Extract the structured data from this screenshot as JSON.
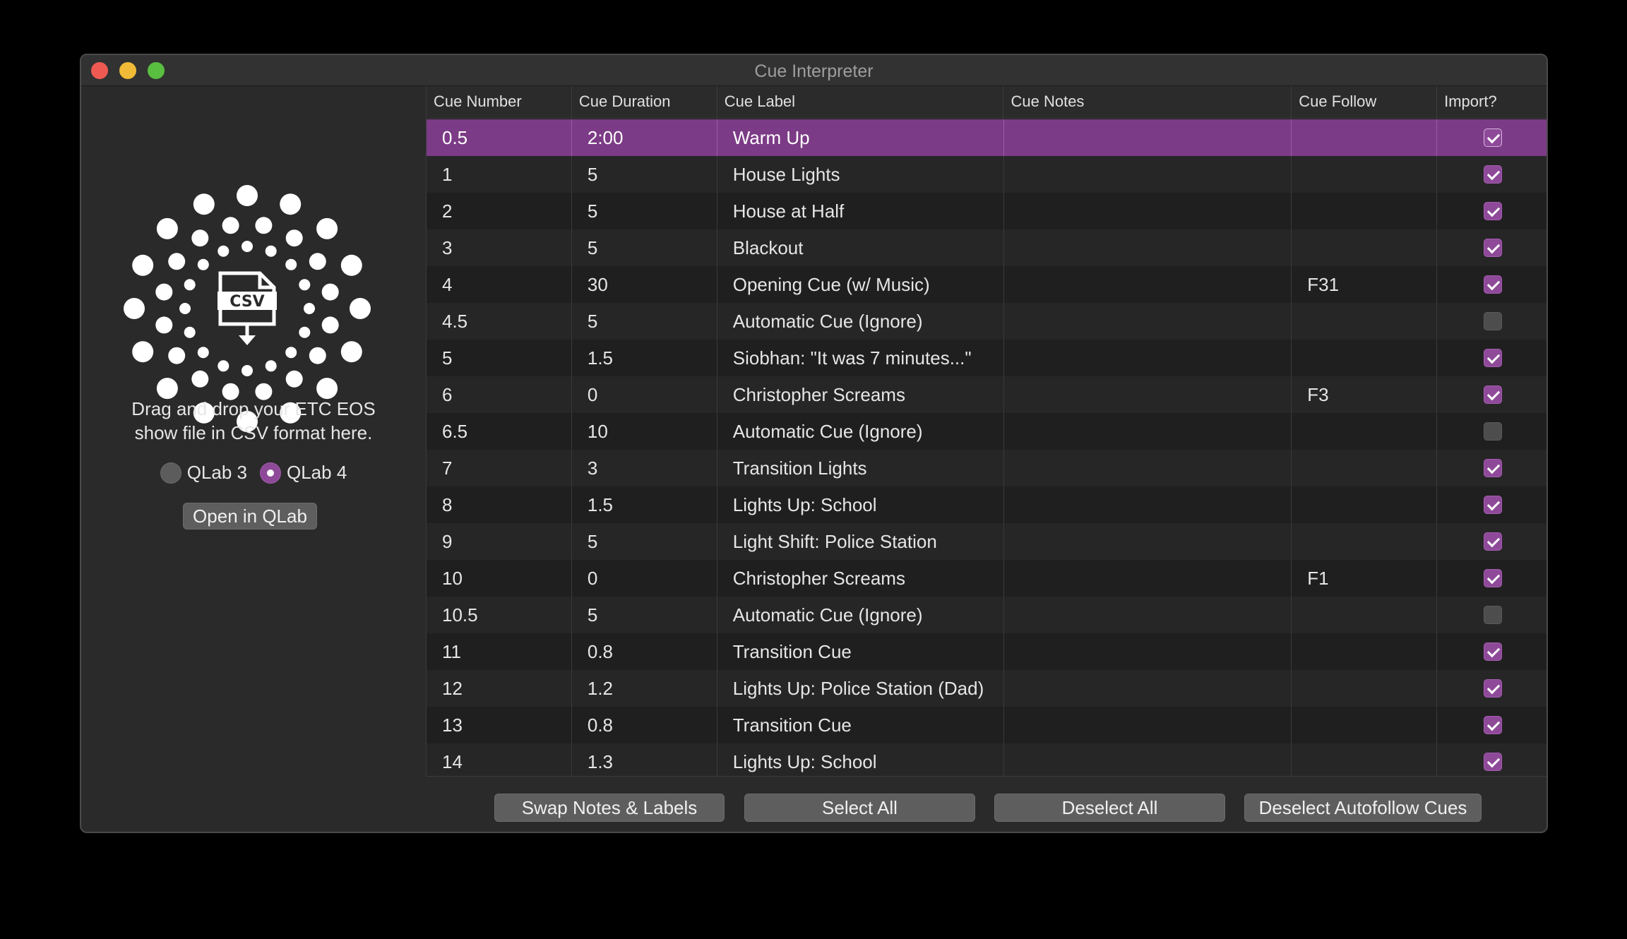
{
  "window": {
    "title": "Cue Interpreter"
  },
  "left_pane": {
    "drop_icon": "csv-file-download-icon",
    "drop_icon_text": "CSV",
    "instructions_line1": "Drag and drop your ETC EOS",
    "instructions_line2": "show file in CSV format here.",
    "radio_options": [
      {
        "label": "QLab 3",
        "selected": false
      },
      {
        "label": "QLab 4",
        "selected": true
      }
    ],
    "open_button": "Open in QLab"
  },
  "table": {
    "columns": [
      "Cue Number",
      "Cue Duration",
      "Cue Label",
      "Cue Notes",
      "Cue Follow",
      "Import?"
    ],
    "rows": [
      {
        "number": "0.5",
        "duration": "2:00",
        "label": "Warm Up",
        "notes": "",
        "follow": "",
        "import": true,
        "selected": true
      },
      {
        "number": "1",
        "duration": "5",
        "label": "House Lights",
        "notes": "",
        "follow": "",
        "import": true
      },
      {
        "number": "2",
        "duration": "5",
        "label": "House at Half",
        "notes": "",
        "follow": "",
        "import": true
      },
      {
        "number": "3",
        "duration": "5",
        "label": "Blackout",
        "notes": "",
        "follow": "",
        "import": true
      },
      {
        "number": "4",
        "duration": "30",
        "label": "Opening Cue (w/ Music)",
        "notes": "",
        "follow": "F31",
        "import": true
      },
      {
        "number": "4.5",
        "duration": "5",
        "label": "Automatic Cue (Ignore)",
        "notes": "",
        "follow": "",
        "import": false
      },
      {
        "number": "5",
        "duration": "1.5",
        "label": "Siobhan: \"It was 7 minutes...\"",
        "notes": "",
        "follow": "",
        "import": true
      },
      {
        "number": "6",
        "duration": "0",
        "label": "Christopher Screams",
        "notes": "",
        "follow": "F3",
        "import": true
      },
      {
        "number": "6.5",
        "duration": "10",
        "label": "Automatic Cue (Ignore)",
        "notes": "",
        "follow": "",
        "import": false
      },
      {
        "number": "7",
        "duration": "3",
        "label": "Transition Lights",
        "notes": "",
        "follow": "",
        "import": true
      },
      {
        "number": "8",
        "duration": "1.5",
        "label": "Lights Up: School",
        "notes": "",
        "follow": "",
        "import": true
      },
      {
        "number": "9",
        "duration": "5",
        "label": "Light Shift: Police Station",
        "notes": "",
        "follow": "",
        "import": true
      },
      {
        "number": "10",
        "duration": "0",
        "label": "Christopher Screams",
        "notes": "",
        "follow": "F1",
        "import": true
      },
      {
        "number": "10.5",
        "duration": "5",
        "label": "Automatic Cue (Ignore)",
        "notes": "",
        "follow": "",
        "import": false
      },
      {
        "number": "11",
        "duration": "0.8",
        "label": "Transition Cue",
        "notes": "",
        "follow": "",
        "import": true
      },
      {
        "number": "12",
        "duration": "1.2",
        "label": "Lights Up: Police Station (Dad)",
        "notes": "",
        "follow": "",
        "import": true
      },
      {
        "number": "13",
        "duration": "0.8",
        "label": "Transition Cue",
        "notes": "",
        "follow": "",
        "import": true
      },
      {
        "number": "14",
        "duration": "1.3",
        "label": "Lights Up: School",
        "notes": "",
        "follow": "",
        "import": true
      }
    ]
  },
  "bottom_buttons": {
    "swap": "Swap Notes & Labels",
    "select_all": "Select All",
    "deselect_all": "Deselect All",
    "deselect_autofollow": "Deselect Autofollow Cues"
  },
  "colors": {
    "accent": "#8e4a99",
    "selected_row": "#7c3b86",
    "close": "#ee5a52",
    "minimize": "#f2bb37",
    "maximize": "#59bf40"
  }
}
